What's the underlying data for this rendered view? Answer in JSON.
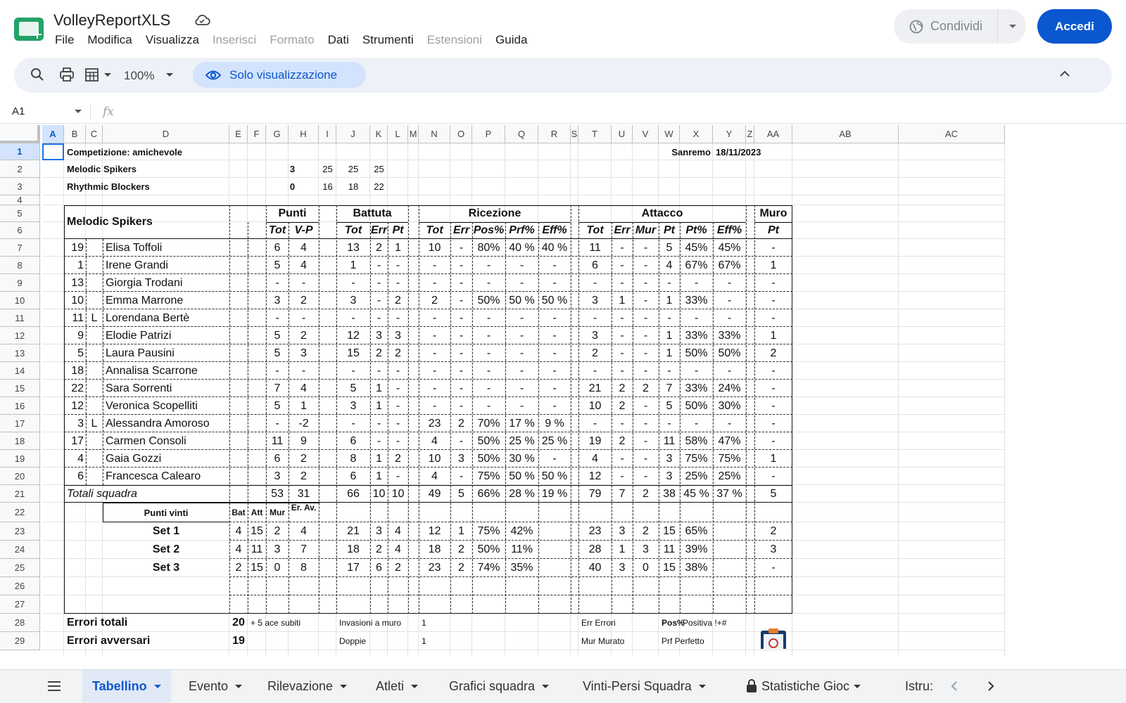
{
  "app": {
    "title": "VolleyReportXLS",
    "menu": [
      {
        "label": "File",
        "enabled": true
      },
      {
        "label": "Modifica",
        "enabled": true
      },
      {
        "label": "Visualizza",
        "enabled": true
      },
      {
        "label": "Inserisci",
        "enabled": false
      },
      {
        "label": "Formato",
        "enabled": false
      },
      {
        "label": "Dati",
        "enabled": true
      },
      {
        "label": "Strumenti",
        "enabled": true
      },
      {
        "label": "Estensioni",
        "enabled": false
      },
      {
        "label": "Guida",
        "enabled": true
      }
    ],
    "share_label": "Condividi",
    "login_label": "Accedi",
    "accent": "#0b57d0",
    "brand": "#21a366"
  },
  "toolbar": {
    "zoom": "100%",
    "view_only_label": "Solo visualizzazione",
    "icons": [
      "search-icon",
      "print-icon",
      "filter-views-icon",
      "eye-icon",
      "chevron-up-icon"
    ]
  },
  "formula_bar": {
    "cell_ref": "A1",
    "fx_label": "fx"
  },
  "grid": {
    "selected_cell": "A1",
    "columns": [
      "A",
      "B",
      "C",
      "D",
      "E",
      "F",
      "G",
      "H",
      "I",
      "J",
      "K",
      "L",
      "M",
      "N",
      "O",
      "P",
      "Q",
      "R",
      "S",
      "T",
      "U",
      "V",
      "W",
      "X",
      "Y",
      "Z",
      "AA",
      "AB",
      "AC"
    ],
    "rows": [
      "1",
      "2",
      "3",
      "4",
      "5",
      "6",
      "7",
      "8",
      "9",
      "10",
      "11",
      "12",
      "13",
      "14",
      "15",
      "16",
      "17",
      "18",
      "19",
      "20",
      "21",
      "22",
      "23",
      "24",
      "25",
      "26",
      "27",
      "28",
      "29"
    ]
  },
  "report": {
    "competition": "Competizione: amichevole",
    "place": "Sanremo",
    "date": "18/11/2023",
    "teams": [
      {
        "name": "Melodic Spikers",
        "sets": "3",
        "scores": [
          "25",
          "25",
          "25"
        ]
      },
      {
        "name": "Rhythmic Blockers",
        "sets": "0",
        "scores": [
          "16",
          "18",
          "22"
        ]
      }
    ],
    "team_header": "Melodic Spikers",
    "groups": [
      "Punti",
      "Battuta",
      "Ricezione",
      "Attacco",
      "Muro"
    ],
    "subheaders": {
      "punti": [
        "Tot",
        "V-P"
      ],
      "battuta": [
        "Tot",
        "Err",
        "Pt"
      ],
      "ricezione": [
        "Tot",
        "Err",
        "Pos%",
        "Prf%",
        "Eff%"
      ],
      "attacco": [
        "Tot",
        "Err",
        "Mur",
        "Pt",
        "Pt%",
        "Eff%"
      ],
      "muro": [
        "Pt"
      ]
    },
    "players": [
      {
        "num": "19",
        "role": "",
        "name": "Elisa Toffoli",
        "p": [
          "6",
          "4"
        ],
        "b": [
          "13",
          "2",
          "1"
        ],
        "r": [
          "10",
          "-",
          "80%",
          "40 %",
          "40 %"
        ],
        "a": [
          "11",
          "-",
          "-",
          "5",
          "45%",
          "45%"
        ],
        "m": "-"
      },
      {
        "num": "1",
        "role": "",
        "name": "Irene Grandi",
        "p": [
          "5",
          "4"
        ],
        "b": [
          "1",
          "-",
          "-"
        ],
        "r": [
          "-",
          "-",
          "-",
          "-",
          "-"
        ],
        "a": [
          "6",
          "-",
          "-",
          "4",
          "67%",
          "67%"
        ],
        "m": "1"
      },
      {
        "num": "13",
        "role": "",
        "name": "Giorgia Trodani",
        "p": [
          "-",
          "-"
        ],
        "b": [
          "-",
          "-",
          "-"
        ],
        "r": [
          "-",
          "-",
          "-",
          "-",
          "-"
        ],
        "a": [
          "-",
          "-",
          "-",
          "-",
          "-",
          "-"
        ],
        "m": "-"
      },
      {
        "num": "10",
        "role": "",
        "name": "Emma Marrone",
        "p": [
          "3",
          "2"
        ],
        "b": [
          "3",
          "-",
          "2"
        ],
        "r": [
          "2",
          "-",
          "50%",
          "50 %",
          "50 %"
        ],
        "a": [
          "3",
          "1",
          "-",
          "1",
          "33%",
          "-"
        ],
        "m": "-"
      },
      {
        "num": "11",
        "role": "L",
        "name": "Lorendana Bertè",
        "p": [
          "-",
          "-"
        ],
        "b": [
          "-",
          "-",
          "-"
        ],
        "r": [
          "-",
          "-",
          "-",
          "-",
          "-"
        ],
        "a": [
          "-",
          "-",
          "-",
          "-",
          "-",
          "-"
        ],
        "m": "-"
      },
      {
        "num": "9",
        "role": "",
        "name": "Elodie Patrizi",
        "p": [
          "5",
          "2"
        ],
        "b": [
          "12",
          "3",
          "3"
        ],
        "r": [
          "-",
          "-",
          "-",
          "-",
          "-"
        ],
        "a": [
          "3",
          "-",
          "-",
          "1",
          "33%",
          "33%"
        ],
        "m": "1"
      },
      {
        "num": "5",
        "role": "",
        "name": "Laura Pausini",
        "p": [
          "5",
          "3"
        ],
        "b": [
          "15",
          "2",
          "2"
        ],
        "r": [
          "-",
          "-",
          "-",
          "-",
          "-"
        ],
        "a": [
          "2",
          "-",
          "-",
          "1",
          "50%",
          "50%"
        ],
        "m": "2"
      },
      {
        "num": "18",
        "role": "",
        "name": "Annalisa Scarrone",
        "p": [
          "-",
          "-"
        ],
        "b": [
          "-",
          "-",
          "-"
        ],
        "r": [
          "-",
          "-",
          "-",
          "-",
          "-"
        ],
        "a": [
          "-",
          "-",
          "-",
          "-",
          "-",
          "-"
        ],
        "m": "-"
      },
      {
        "num": "22",
        "role": "",
        "name": "Sara Sorrenti",
        "p": [
          "7",
          "4"
        ],
        "b": [
          "5",
          "1",
          "-"
        ],
        "r": [
          "-",
          "-",
          "-",
          "-",
          "-"
        ],
        "a": [
          "21",
          "2",
          "2",
          "7",
          "33%",
          "24%"
        ],
        "m": "-"
      },
      {
        "num": "12",
        "role": "",
        "name": "Veronica Scopelliti",
        "p": [
          "5",
          "1"
        ],
        "b": [
          "3",
          "1",
          "-"
        ],
        "r": [
          "-",
          "-",
          "-",
          "-",
          "-"
        ],
        "a": [
          "10",
          "2",
          "-",
          "5",
          "50%",
          "30%"
        ],
        "m": "-"
      },
      {
        "num": "3",
        "role": "L",
        "name": "Alessandra Amoroso",
        "p": [
          "-",
          "-2"
        ],
        "b": [
          "-",
          "-",
          "-"
        ],
        "r": [
          "23",
          "2",
          "70%",
          "17 %",
          "9 %"
        ],
        "a": [
          "-",
          "-",
          "-",
          "-",
          "-",
          "-"
        ],
        "m": "-"
      },
      {
        "num": "17",
        "role": "",
        "name": "Carmen Consoli",
        "p": [
          "11",
          "9"
        ],
        "b": [
          "6",
          "-",
          "-"
        ],
        "r": [
          "4",
          "-",
          "50%",
          "25 %",
          "25 %"
        ],
        "a": [
          "19",
          "2",
          "-",
          "11",
          "58%",
          "47%"
        ],
        "m": "-"
      },
      {
        "num": "4",
        "role": "",
        "name": "Gaia Gozzi",
        "p": [
          "6",
          "2"
        ],
        "b": [
          "8",
          "1",
          "2"
        ],
        "r": [
          "10",
          "3",
          "50%",
          "30 %",
          "-"
        ],
        "a": [
          "4",
          "-",
          "-",
          "3",
          "75%",
          "75%"
        ],
        "m": "1"
      },
      {
        "num": "6",
        "role": "",
        "name": "Francesca Calearo",
        "p": [
          "3",
          "2"
        ],
        "b": [
          "6",
          "1",
          "-"
        ],
        "r": [
          "4",
          "-",
          "75%",
          "50 %",
          "50 %"
        ],
        "a": [
          "12",
          "-",
          "-",
          "3",
          "25%",
          "25%"
        ],
        "m": "-"
      }
    ],
    "totals": {
      "label": "Totali squadra",
      "p": [
        "53",
        "31"
      ],
      "b": [
        "66",
        "10",
        "10"
      ],
      "r": [
        "49",
        "5",
        "66%",
        "28 %",
        "19 %"
      ],
      "a": [
        "79",
        "7",
        "2",
        "38",
        "45 %",
        "37 %"
      ],
      "m": "5"
    },
    "sets_header": {
      "label": "Punti vinti",
      "cols": [
        "Bat",
        "Att",
        "Mur",
        "Er. Av."
      ]
    },
    "sets": [
      {
        "label": "Set 1",
        "pv": [
          "4",
          "15",
          "2",
          "4"
        ],
        "b": [
          "21",
          "3",
          "4"
        ],
        "r": [
          "12",
          "1",
          "75%",
          "42%"
        ],
        "a": [
          "23",
          "3",
          "2",
          "15",
          "65%"
        ],
        "m": "2"
      },
      {
        "label": "Set 2",
        "pv": [
          "4",
          "11",
          "3",
          "7"
        ],
        "b": [
          "18",
          "2",
          "4"
        ],
        "r": [
          "18",
          "2",
          "50%",
          "11%"
        ],
        "a": [
          "28",
          "1",
          "3",
          "11",
          "39%"
        ],
        "m": "3"
      },
      {
        "label": "Set 3",
        "pv": [
          "2",
          "15",
          "0",
          "8"
        ],
        "b": [
          "17",
          "6",
          "2"
        ],
        "r": [
          "23",
          "2",
          "74%",
          "35%"
        ],
        "a": [
          "40",
          "3",
          "0",
          "15",
          "38%"
        ],
        "m": "-"
      }
    ],
    "footer": {
      "errori_totali_label": "Errori totali",
      "errori_totali_value": "20",
      "ace_subiti": "+ 5 ace subiti",
      "errori_avversari_label": "Errori avversari",
      "errori_avversari_value": "19",
      "invasioni_label": "Invasioni a muro",
      "invasioni_value": "1",
      "doppie_label": "Doppie",
      "doppie_value": "1",
      "legend_err": "Err Errori",
      "legend_mur": "Mur Murato",
      "legend_pos": "Pos%",
      "legend_pos_desc": "Positiva !+#",
      "legend_prf": "Prf Perfetto"
    }
  },
  "sheet_tabs": [
    {
      "label": "Tabellino",
      "active": true,
      "locked": false
    },
    {
      "label": "Evento",
      "active": false,
      "locked": false
    },
    {
      "label": "Rilevazione",
      "active": false,
      "locked": false
    },
    {
      "label": "Atleti",
      "active": false,
      "locked": false
    },
    {
      "label": "Grafici squadra",
      "active": false,
      "locked": false
    },
    {
      "label": "Vinti-Persi Squadra",
      "active": false,
      "locked": false
    },
    {
      "label": "Statistiche Gioc",
      "active": false,
      "locked": true
    },
    {
      "label": "Istru:",
      "active": false,
      "locked": false
    }
  ]
}
